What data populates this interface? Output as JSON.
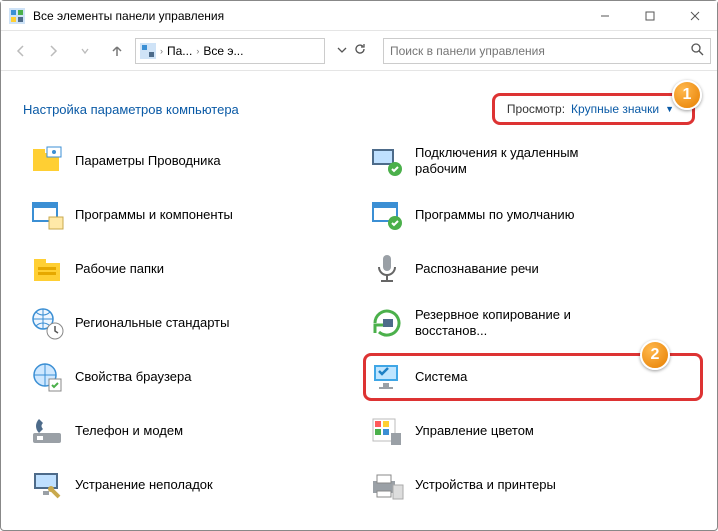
{
  "window": {
    "title": "Все элементы панели управления"
  },
  "nav": {
    "crumb1": "Па...",
    "crumb2": "Все э...",
    "search_placeholder": "Поиск в панели управления"
  },
  "heading": "Настройка параметров компьютера",
  "view": {
    "label": "Просмотр:",
    "value": "Крупные значки"
  },
  "badges": {
    "one": "1",
    "two": "2"
  },
  "items": {
    "left": [
      {
        "label": "Параметры Проводника"
      },
      {
        "label": "Программы и компоненты"
      },
      {
        "label": "Рабочие папки"
      },
      {
        "label": "Региональные стандарты"
      },
      {
        "label": "Свойства браузера"
      },
      {
        "label": "Телефон и модем"
      },
      {
        "label": "Устранение неполадок"
      }
    ],
    "right": [
      {
        "label": "Подключения к удаленным рабочим"
      },
      {
        "label": "Программы по умолчанию"
      },
      {
        "label": "Распознавание речи"
      },
      {
        "label": "Резервное копирование и восстанов..."
      },
      {
        "label": "Система"
      },
      {
        "label": "Управление цветом"
      },
      {
        "label": "Устройства и принтеры"
      }
    ]
  }
}
